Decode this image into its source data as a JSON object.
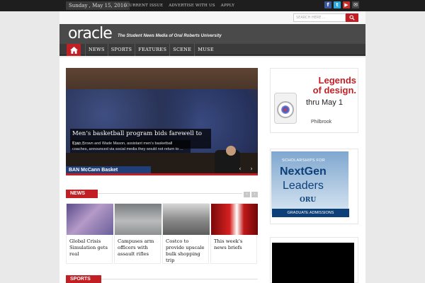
{
  "topbar": {
    "date": "Sunday , May 15, 2016",
    "links": [
      "CURRENT ISSUE",
      "ADVERTISE WITH US",
      "APPLY"
    ],
    "social_icons": [
      "facebook-icon",
      "twitter-icon",
      "youtube-icon",
      "email-icon"
    ]
  },
  "search": {
    "placeholder": "SEARCH HERE ..."
  },
  "masthead": {
    "logo": "oracle",
    "tagline": "The Student News Media of Oral Roberts University"
  },
  "mainnav": {
    "items": [
      "NEWS",
      "SPORTS",
      "FEATURES",
      "SCENE",
      "MUSE"
    ]
  },
  "slider": {
    "title": "Men’s basketball program bids farewell to tw...",
    "excerpt": "Kyan Brown and Wade Mason, assistant men’s basketball coaches, announced via social media they would not return to ...",
    "banner": "BAN McCann Basket"
  },
  "news": {
    "heading": "NEWS",
    "cards": [
      {
        "title": "Global Crisis Simulation gets real"
      },
      {
        "title": "Campuses arm officers with assault rifles"
      },
      {
        "title": "Costco to provide upscale bulk shopping trip"
      },
      {
        "title": "This week’s news briefs"
      }
    ]
  },
  "sports": {
    "heading": "SPORTS"
  },
  "ads": {
    "ad1": {
      "headline": "Legends of design.",
      "line1": "Legends",
      "line2": "of design.",
      "date": "thru May 1",
      "brand": "Philbrook"
    },
    "ad2": {
      "top": "SCHOLARSHIPS FOR",
      "line1": "NextGen",
      "line2": "Leaders",
      "org": "ORU",
      "footer": "GRADUATE ADMISSIONS"
    }
  },
  "colors": {
    "accent": "#c21f24",
    "nav": "#3b3b3b",
    "masthead": "#4a4a4a"
  }
}
